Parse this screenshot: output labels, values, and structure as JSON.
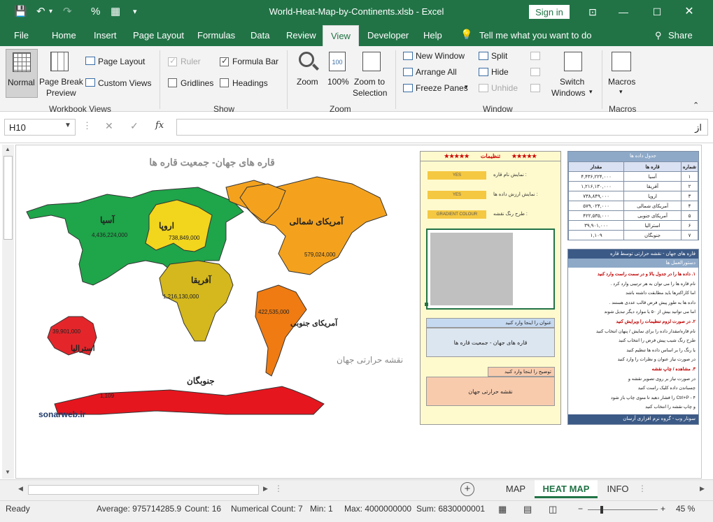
{
  "window": {
    "title": "World-Heat-Map-by-Continents.xlsb  -  Excel",
    "signin": "Sign in",
    "qa_save": "💾",
    "qa_undo": "↶",
    "qa_redo": "↷",
    "qa_percent": "%",
    "qa_calc": "▦",
    "qa_more": "▾"
  },
  "ribbon_tabs": [
    "File",
    "Home",
    "Insert",
    "Page Layout",
    "Formulas",
    "Data",
    "Review",
    "View",
    "Developer",
    "Help"
  ],
  "active_tab": "View",
  "tell_me": "Tell me what you want to do",
  "share": "Share",
  "ribbon": {
    "workbook_views": {
      "label": "Workbook Views",
      "normal": "Normal",
      "page_break": [
        "Page Break",
        "Preview"
      ],
      "page_layout": "Page Layout",
      "custom_views": "Custom Views"
    },
    "show": {
      "label": "Show",
      "ruler": "Ruler",
      "formula_bar": "Formula Bar",
      "gridlines": "Gridlines",
      "headings": "Headings",
      "ruler_checked": true,
      "formula_bar_checked": true,
      "gridlines_checked": false,
      "headings_checked": false
    },
    "zoom": {
      "label": "Zoom",
      "zoom": "Zoom",
      "hundred": "100%",
      "zoom_sel": [
        "Zoom to",
        "Selection"
      ]
    },
    "window": {
      "label": "Window",
      "new_window": "New Window",
      "arrange_all": "Arrange All",
      "freeze_panes": "Freeze Panes",
      "split": "Split",
      "hide": "Hide",
      "unhide": "Unhide",
      "switch": [
        "Switch",
        "Windows"
      ]
    },
    "macros": {
      "label": "Macros",
      "macros": "Macros"
    }
  },
  "formula_bar": {
    "name_box": "H10",
    "value": "از"
  },
  "sheet": {
    "map_title": "قاره های جهان- جمعیت قاره ها",
    "watermark": "نقشه حرارتی جهان",
    "credit": "sonarweb.ir",
    "continents": [
      {
        "name": "آسیا",
        "value": "4,436,224,000",
        "color": "#1fa54a"
      },
      {
        "name": "اروپا",
        "value": "738,849,000",
        "color": "#f2d51d"
      },
      {
        "name": "آفریقا",
        "value": "1,216,130,000",
        "color": "#d4b81d"
      },
      {
        "name": "آمریکای شمالی",
        "value": "579,024,000",
        "color": "#f4a21e"
      },
      {
        "name": "آمریکای جنوبی",
        "value": "422,535,000",
        "color": "#ef7b12"
      },
      {
        "name": "استرالیا",
        "value": "39,901,000",
        "color": "#e4262b"
      },
      {
        "name": "جنوبگان",
        "value": "1,109",
        "color": "#e6161e"
      }
    ],
    "settings": {
      "header": "تنظیمات",
      "stars": "★★★★★",
      "rows": [
        {
          "label": "نمایش نام قاره :",
          "value": "YES"
        },
        {
          "label": "نمایش ارزش داده ها :",
          "value": "YES"
        },
        {
          "label": "طرح رنگ نقشه :",
          "value": "GRADIENT COLOUR"
        }
      ],
      "title_prompt": "عنوان را اینجا وارد کنید",
      "title_value": "قاره های جهان - جمعیت  قاره ها",
      "desc_prompt": "توضیح را اینجا وارد کنید",
      "desc_value": "نقشه حرارتی جهان"
    },
    "data_table": {
      "title": "جدول داده ها",
      "columns": [
        "شماره",
        "قاره ها",
        "مقدار"
      ],
      "rows": [
        [
          "۱",
          "آسیا",
          "۴,۴۳۶,۲۲۴,۰۰۰"
        ],
        [
          "۲",
          "آفریقا",
          "۱,۲۱۶,۱۳۰,۰۰۰"
        ],
        [
          "۳",
          "اروپا",
          "۷۳۸,۸۴۹,۰۰۰"
        ],
        [
          "۴",
          "آمریکای شمالی",
          "۵۷۹,۰۲۴,۰۰۰"
        ],
        [
          "۵",
          "آمریکای جنوبی",
          "۴۲۲,۵۳۵,۰۰۰"
        ],
        [
          "۶",
          "استرالیا",
          "۳۹,۹۰۱,۰۰۰"
        ],
        [
          "۷",
          "جنوبگان",
          "۱,۱۰۹"
        ]
      ]
    },
    "instructions": {
      "title": "قاره های جهان - نقشه حرارتی توسط قاره",
      "subtitle": "دستورالعمل ها",
      "lines": [
        "۱. داده ها را در جدول بالا و در سمت راست وارد کنید",
        "نام قاره ها را می توان به هر ترتیبی وارد کرد .",
        "اما کاراکترها باید مطابقت داشته باشد",
        "داده ها به طور پیش فرض قالب عددی هستند .",
        "اما می توانید بیش از ۵۰ یا موارد دیگر تبدیل شوند",
        "۲. در صورت لزوم تنظیمات را ویرایش کنید",
        "نام قاره/مقدار داده را برای نمایش / پنهان انتخاب کنید",
        "طرح رنگ شیب پیش فرض را انتخاب کنید",
        "یا رنگ را بر اساس داده ها تنظیم کنید",
        "در صورت نیاز عنوان و نظرات را وارد کنید",
        "۳. مشاهده / چاپ نقشه",
        "در صورت نیاز بر روی تصویر نقشه و",
        "چسباندن داده کلیک راست کنید",
        "۴ - Ctrl+P را فشار دهید تا منوی چاپ باز شود",
        "و چاپ نقشه را انتخاب کنید"
      ],
      "footer": "سونار وب  -  گروه نرم افزاری آرسان"
    }
  },
  "sheet_tabs": [
    "MAP",
    "HEAT MAP",
    "INFO"
  ],
  "active_sheet": "HEAT MAP",
  "status": {
    "ready": "Ready",
    "average": "Average: 975714285.9",
    "count": "Count: 16",
    "numerical_count": "Numerical Count: 7",
    "min": "Min: 1",
    "max": "Max: 4000000000",
    "sum": "Sum: 6830000001",
    "zoom": "45 %"
  }
}
